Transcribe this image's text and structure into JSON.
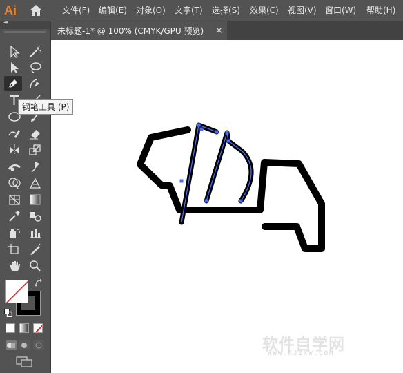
{
  "app": {
    "logo_text": "Ai"
  },
  "menubar": {
    "items": [
      {
        "label": "文件(F)"
      },
      {
        "label": "编辑(E)"
      },
      {
        "label": "对象(O)"
      },
      {
        "label": "文字(T)"
      },
      {
        "label": "选择(S)"
      },
      {
        "label": "效果(C)"
      },
      {
        "label": "视图(V)"
      },
      {
        "label": "窗口(W)"
      },
      {
        "label": "帮助(H)"
      }
    ]
  },
  "document": {
    "tab_title": "未标题-1* @ 100% (CMYK/GPU 预览)",
    "close_glyph": "×"
  },
  "toolbar": {
    "collapse_glyph": "◂◂",
    "tooltip": "钢笔工具 (P)",
    "tools": [
      "selection-tool",
      "magic-wand-tool",
      "direct-selection-tool",
      "lasso-tool",
      "pen-tool",
      "curvature-tool",
      "type-tool",
      "line-segment-tool",
      "ellipse-tool",
      "paintbrush-tool",
      "shaper-tool",
      "eraser-tool",
      "rotate-tool",
      "scale-tool",
      "width-tool",
      "free-transform-tool",
      "shape-builder-tool",
      "live-paint-tool",
      "perspective-grid-tool",
      "mesh-tool",
      "gradient-tool",
      "eyedropper-tool",
      "blend-tool",
      "symbol-sprayer-tool",
      "column-graph-tool",
      "artboard-tool",
      "slice-tool",
      "hand-tool",
      "zoom-tool"
    ],
    "fill_color": "#ffffff",
    "stroke_color": "#000000",
    "active_tool": "pen-tool"
  },
  "colors": {
    "accent": "#e8822f",
    "path_highlight": "#4a6cf0",
    "stroke": "#000000"
  },
  "watermark": {
    "text": "软件自学网",
    "sub": "WWW.RJZXW.COM"
  }
}
